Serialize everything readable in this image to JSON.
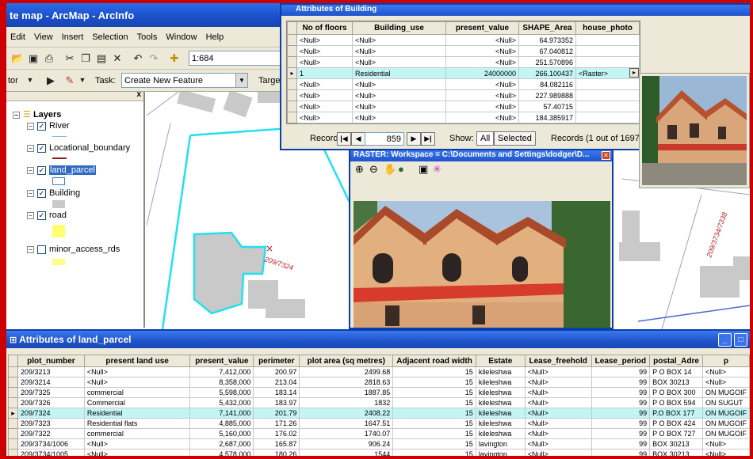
{
  "app": {
    "title": "te map - ArcMap - ArcInfo"
  },
  "menu": [
    "Edit",
    "View",
    "Insert",
    "Selection",
    "Tools",
    "Window",
    "Help"
  ],
  "toolbar": {
    "scale_value": "1:684",
    "task_label": "Task:",
    "task_value": "Create New Feature",
    "editor_label": "tor",
    "target_label": "Targe"
  },
  "toc": {
    "root": "Layers",
    "layers": [
      {
        "name": "River",
        "checked": true
      },
      {
        "name": "Locational_boundary",
        "checked": true
      },
      {
        "name": "land_parcel",
        "checked": true
      },
      {
        "name": "Building",
        "checked": true
      },
      {
        "name": "road",
        "checked": true
      },
      {
        "name": "minor_access_rds",
        "checked": false
      }
    ],
    "close": "x"
  },
  "map": {
    "labels": [
      "209/7324",
      "209/3734/7338"
    ],
    "marker": "×"
  },
  "building_window": {
    "title": "Attributes of Building",
    "columns": [
      "No of floors",
      "Building_use",
      "present_value",
      "SHAPE_Area",
      "house_photo"
    ],
    "rows": [
      [
        "<Null>",
        "<Null>",
        "<Null>",
        "64.973352",
        ""
      ],
      [
        "<Null>",
        "<Null>",
        "<Null>",
        "67.040812",
        ""
      ],
      [
        "<Null>",
        "<Null>",
        "<Null>",
        "251.570896",
        ""
      ],
      [
        "1",
        "Residential",
        "24000000",
        "266.100437",
        "<Raster>"
      ],
      [
        "<Null>",
        "<Null>",
        "<Null>",
        "84.082116",
        ""
      ],
      [
        "<Null>",
        "<Null>",
        "<Null>",
        "227.989888",
        ""
      ],
      [
        "<Null>",
        "<Null>",
        "<Null>",
        "57.40715",
        ""
      ],
      [
        "<Null>",
        "<Null>",
        "<Null>",
        "184.385917",
        ""
      ]
    ],
    "selected_row": 3,
    "record_label": "Record:",
    "record_value": "859",
    "show_label": "Show:",
    "show_all": "All",
    "show_selected": "Selected",
    "records_info": "Records (1 out of 1697 Se"
  },
  "raster_window": {
    "title": "RASTER: Workspace = C:\\Documents and Settings\\dodger\\D..."
  },
  "parcel_window": {
    "title": "Attributes of land_parcel",
    "columns": [
      "plot_number",
      "present land use",
      "present_value",
      "perimeter",
      "plot area (sq metres)",
      "Adjacent road width",
      "Estate",
      "Lease_freehold",
      "Lease_period",
      "postal_Adre",
      "p"
    ],
    "rows": [
      [
        "209/3213",
        "<Null>",
        "7,412,000",
        "200.97",
        "2499.68",
        "15",
        "kileleshwa",
        "<Null>",
        "99",
        "P O BOX 14",
        "<Null>"
      ],
      [
        "209/3214",
        "<Null>",
        "8,358,000",
        "213.04",
        "2818.63",
        "15",
        "kileleshwa",
        "<Null>",
        "99",
        "BOX 30213",
        "<Null>"
      ],
      [
        "209/7325",
        "commercial",
        "5,598,000",
        "183.14",
        "1887.85",
        "15",
        "kileleshwa",
        "<Null>",
        "99",
        "P O BOX  300",
        "ON MUGOIF"
      ],
      [
        "209/7326",
        "Commercial",
        "5,432,000",
        "183.97",
        "1832",
        "15",
        "kileleshwa",
        "<Null>",
        "99",
        "P O BOX 594",
        "ON SUGUT"
      ],
      [
        "209/7324",
        "Residential",
        "7,141,000",
        "201.79",
        "2408.22",
        "15",
        "kileleshwa",
        "<Null>",
        "99",
        "P.O BOX 177",
        "ON MUGOIF"
      ],
      [
        "209/7323",
        "Residential flats",
        "4,885,000",
        "171.26",
        "1647.51",
        "15",
        "kileleshwa",
        "<Null>",
        "99",
        "P O BOX 424",
        "ON MUGOIF"
      ],
      [
        "209/7322",
        "commercial",
        "5,160,000",
        "176.02",
        "1740.07",
        "15",
        "kileleshwa",
        "<Null>",
        "99",
        "P O BOX 727",
        "ON MUGOIF"
      ],
      [
        "209/3734/1006",
        "<Null>",
        "2,687,000",
        "165.87",
        "906.24",
        "15",
        "lavington",
        "<Null>",
        "99",
        "BOX 30213",
        "<Null>"
      ],
      [
        "209/3734/1005",
        "<Null>",
        "4,578,000",
        "180.26",
        "1544",
        "15",
        "lavington",
        "<Null>",
        "99",
        "BOX 30213",
        "<Null>"
      ]
    ],
    "selected_row": 4
  },
  "colors": {
    "frame": "#cc0000",
    "titlebar": "#1f53c9",
    "highlight_row": "#c3f5f5",
    "parcel_outline": "#22e0f0",
    "building_fill": "#c9c9c9"
  }
}
